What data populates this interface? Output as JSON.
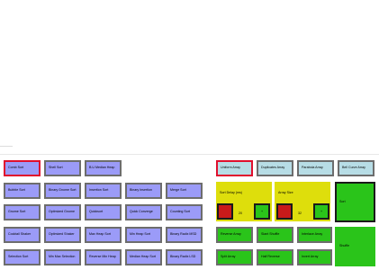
{
  "sorts": {
    "row1": [
      "Comb Sort",
      "Shell Sort",
      "B.U Median Heap"
    ],
    "row2": [
      "Bubble Sort",
      "Binary Gnome Sort",
      "Insertion Sort",
      "Binary Insertion",
      "Merge Sort"
    ],
    "row3": [
      "Gnome Sort",
      "Optimized Gnome",
      "Quicksort",
      "Quick Converge",
      "Counting Sort"
    ],
    "row4": [
      "Cocktail Shaker",
      "Optimized Shaker",
      "Max Heap Sort",
      "Min Heap Sort",
      "Binary Radix MSD"
    ],
    "row5": [
      "Selection Sort",
      "Min Max Selection",
      "Reverse Min Heap",
      "Median Heap Sort",
      "Binary Radix LSD"
    ]
  },
  "arrays": [
    "Uniform Array",
    "Duplicates Array",
    "Parabola Array",
    "Bell Curve Array"
  ],
  "controls": {
    "sort_delay_label": "Sort Delay (ms)",
    "sort_delay_value": "20",
    "sort_delay_plus": "+",
    "array_size_label": "Array Size",
    "array_size_value": "32",
    "array_size_plus": "+",
    "sort_label": "Sort",
    "shuffle_label": "Shuffle"
  },
  "actions": {
    "reverse": "Reverse Array",
    "slant_shuffle": "Slant Shuffle",
    "interlace": "Interlace Array",
    "split": "Split Array",
    "half_reverse": "Half Reverse",
    "invert": "Invert Array"
  },
  "colors": {
    "sort_button": "#9b9bf8",
    "array_button": "#b7dde6",
    "action_button": "#2ac41a",
    "decrement_button": "#c81a1a",
    "control_panel": "#dede0c",
    "selected_border": "#e0102e"
  }
}
